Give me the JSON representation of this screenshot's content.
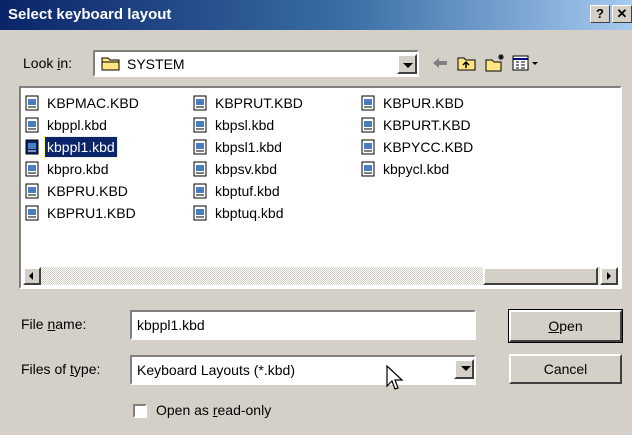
{
  "window": {
    "title": "Select keyboard layout",
    "help_button": "?",
    "close_button": "✕"
  },
  "look_in": {
    "label_pre": "Look ",
    "label_key": "i",
    "label_post": "n:",
    "value": "SYSTEM"
  },
  "toolbar": {
    "icons": [
      "back-arrow-icon",
      "up-folder-icon",
      "new-folder-icon",
      "view-menu-icon"
    ]
  },
  "files": {
    "column_1": [
      "KBPMAC.KBD",
      "kbppl.kbd",
      "kbppl1.kbd",
      "kbpro.kbd",
      "KBPRU.KBD",
      "KBPRU1.KBD"
    ],
    "column_2": [
      "KBPRUT.KBD",
      "kbpsl.kbd",
      "kbpsl1.kbd",
      "kbpsv.kbd",
      "kbptuf.kbd",
      "kbptuq.kbd"
    ],
    "column_3": [
      "KBPUR.KBD",
      "KBPURT.KBD",
      "KBPYCC.KBD",
      "kbpycl.kbd"
    ],
    "selected": "kbppl1.kbd"
  },
  "file_name": {
    "label_pre": "File ",
    "label_key": "n",
    "label_post": "ame:",
    "value": "kbppl1.kbd"
  },
  "file_type": {
    "label_pre": "Files of ",
    "label_key": "t",
    "label_post": "ype:",
    "value": "Keyboard Layouts (*.kbd)"
  },
  "buttons": {
    "open_key": "O",
    "open_rest": "pen",
    "cancel": "Cancel"
  },
  "readonly": {
    "label_pre": "Open as ",
    "label_key": "r",
    "label_post": "ead-only",
    "checked": false
  },
  "colors": {
    "selection": "#0a246a",
    "face": "#d4d0c8",
    "title_start": "#0a246a",
    "title_end": "#a6caf0"
  }
}
